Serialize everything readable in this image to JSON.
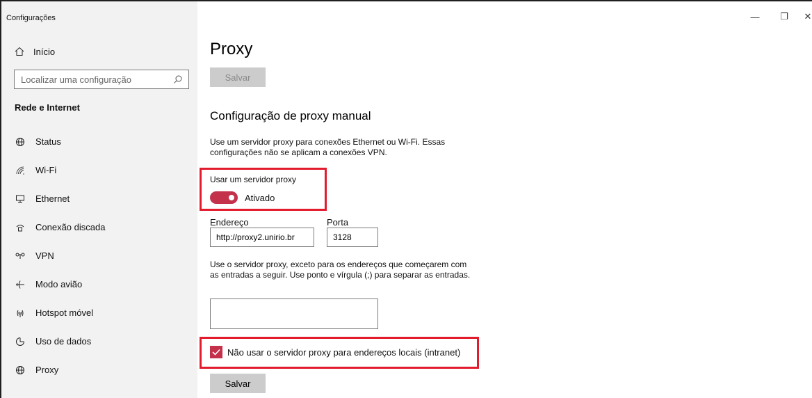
{
  "window": {
    "title": "Configurações",
    "minimize_glyph": "—",
    "restore_glyph": "❐",
    "close_glyph": "✕"
  },
  "sidebar": {
    "home_label": "Início",
    "search_placeholder": "Localizar uma configuração",
    "group_title": "Rede e Internet",
    "items": [
      {
        "label": "Status",
        "icon": "globe-status-icon"
      },
      {
        "label": "Wi-Fi",
        "icon": "wifi-icon"
      },
      {
        "label": "Ethernet",
        "icon": "ethernet-icon"
      },
      {
        "label": "Conexão discada",
        "icon": "dialup-icon"
      },
      {
        "label": "VPN",
        "icon": "vpn-icon"
      },
      {
        "label": "Modo avião",
        "icon": "airplane-icon"
      },
      {
        "label": "Hotspot móvel",
        "icon": "hotspot-icon"
      },
      {
        "label": "Uso de dados",
        "icon": "data-usage-icon"
      },
      {
        "label": "Proxy",
        "icon": "proxy-globe-icon"
      }
    ]
  },
  "main": {
    "title": "Proxy",
    "save_top_label": "Salvar",
    "section_title": "Configuração de proxy manual",
    "description": "Use um servidor proxy para conexões Ethernet ou Wi-Fi. Essas configurações não se aplicam a conexões VPN.",
    "toggle_label": "Usar um servidor proxy",
    "toggle_state": "Ativado",
    "toggle_on": true,
    "address_label": "Endereço",
    "address_value": "http://proxy2.unirio.br",
    "port_label": "Porta",
    "port_value": "3128",
    "exceptions_description": "Use o servidor proxy, exceto para os endereços que começarem com as entradas a seguir. Use ponto e vírgula (;) para separar as entradas.",
    "exceptions_value": "",
    "checkbox_label": "Não usar o servidor proxy para endereços locais (intranet)",
    "checkbox_checked": true,
    "save_bottom_label": "Salvar"
  },
  "colors": {
    "accent": "#c4314b",
    "highlight_border": "#e21b2d",
    "sidebar_bg": "#f2f2f2",
    "button_bg": "#cccccc"
  }
}
